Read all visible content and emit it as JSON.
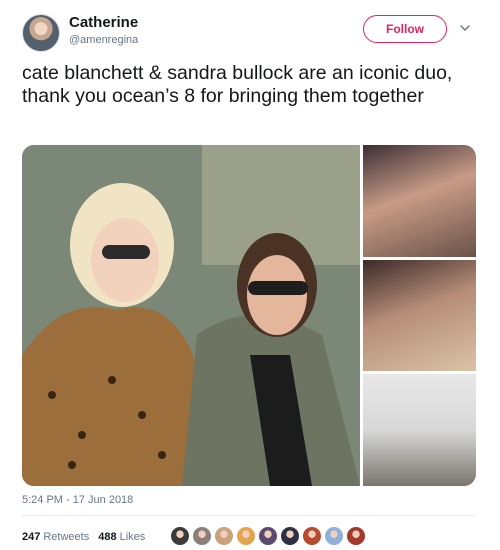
{
  "tweet": {
    "display_name": "Catherine",
    "handle": "@amenregina",
    "follow_label": "Follow",
    "text": "cate blanchett & sandra bullock are an iconic duo, thank you ocean’s 8 for bringing them together",
    "timestamp": "5:24 PM - 17 Jun 2018",
    "retweets_count": "247",
    "retweets_label": "Retweets",
    "likes_count": "488",
    "likes_label": "Likes"
  },
  "colors": {
    "follow_accent": "#e0245e",
    "meta_text": "#657786",
    "body_text": "#14171a"
  },
  "media": {
    "photos": [
      "main-photo",
      "side-photo-top",
      "side-photo-middle",
      "side-photo-bottom"
    ]
  },
  "liker_avatars": [
    {
      "color": "#3b3b3b"
    },
    {
      "color": "#8a7f7a"
    },
    {
      "color": "#c9a27d"
    },
    {
      "color": "#e1a44f"
    },
    {
      "color": "#5a4a6e"
    },
    {
      "color": "#2f2f45"
    },
    {
      "color": "#b84a2f"
    },
    {
      "color": "#8fb0d8"
    },
    {
      "color": "#a33a2a"
    }
  ]
}
